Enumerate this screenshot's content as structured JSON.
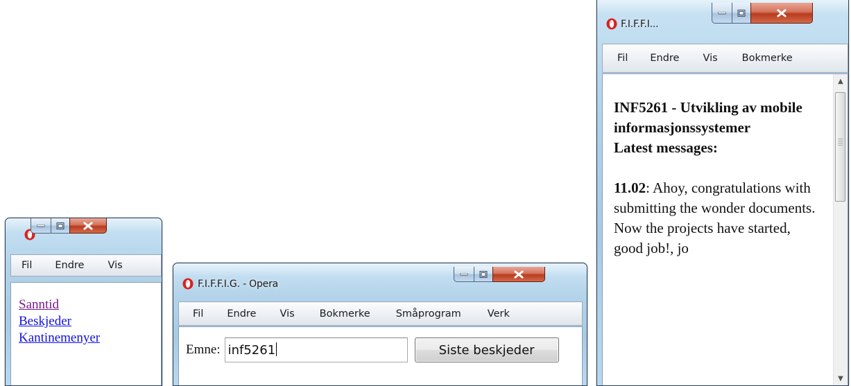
{
  "window_small": {
    "menu": [
      "Fil",
      "Endre",
      "Vis"
    ],
    "links": [
      {
        "label": "Sanntid",
        "visited": true
      },
      {
        "label": "Beskjeder",
        "visited": false
      },
      {
        "label": "Kantinemenyer",
        "visited": false
      }
    ]
  },
  "window_medium": {
    "title": "F.I.F.F.I.G. - Opera",
    "menu": [
      "Fil",
      "Endre",
      "Vis",
      "Bokmerke",
      "Småprogram",
      "Verk"
    ],
    "form": {
      "label": "Emne:",
      "input_value": "inf5261",
      "button_label": "Siste beskjeder"
    }
  },
  "window_large": {
    "title": "F.I.F.F.I...",
    "menu": [
      "Fil",
      "Endre",
      "Vis",
      "Bokmerke"
    ],
    "heading": "INF5261 - Utvikling av mobile informasjonssystemer",
    "subheading": "Latest messages:",
    "message": {
      "date": "11.02",
      "separator": ":",
      "text": "Ahoy, congratulations with submitting the wonder documents. Now the projects have started, good job!, jo"
    }
  },
  "colors": {
    "link": "#1010e0",
    "visited_link": "#7a1a8a",
    "close_button": "#c4482b",
    "frame": "#a8cbe4"
  },
  "icons": [
    "opera-logo-icon",
    "minimize-icon",
    "maximize-icon",
    "close-icon",
    "scroll-up-icon",
    "scroll-down-icon"
  ]
}
